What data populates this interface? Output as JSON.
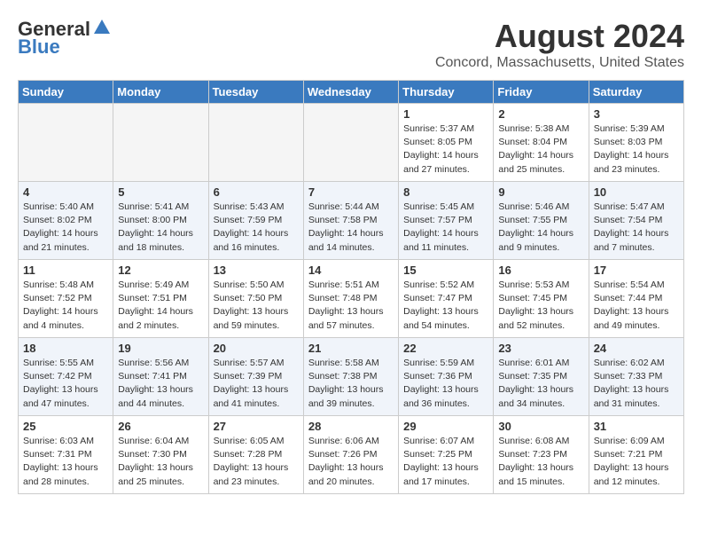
{
  "logo": {
    "general": "General",
    "blue": "Blue"
  },
  "title": "August 2024",
  "location": "Concord, Massachusetts, United States",
  "days_of_week": [
    "Sunday",
    "Monday",
    "Tuesday",
    "Wednesday",
    "Thursday",
    "Friday",
    "Saturday"
  ],
  "weeks": [
    [
      {
        "day": "",
        "info": ""
      },
      {
        "day": "",
        "info": ""
      },
      {
        "day": "",
        "info": ""
      },
      {
        "day": "",
        "info": ""
      },
      {
        "day": "1",
        "info": "Sunrise: 5:37 AM\nSunset: 8:05 PM\nDaylight: 14 hours and 27 minutes."
      },
      {
        "day": "2",
        "info": "Sunrise: 5:38 AM\nSunset: 8:04 PM\nDaylight: 14 hours and 25 minutes."
      },
      {
        "day": "3",
        "info": "Sunrise: 5:39 AM\nSunset: 8:03 PM\nDaylight: 14 hours and 23 minutes."
      }
    ],
    [
      {
        "day": "4",
        "info": "Sunrise: 5:40 AM\nSunset: 8:02 PM\nDaylight: 14 hours and 21 minutes."
      },
      {
        "day": "5",
        "info": "Sunrise: 5:41 AM\nSunset: 8:00 PM\nDaylight: 14 hours and 18 minutes."
      },
      {
        "day": "6",
        "info": "Sunrise: 5:43 AM\nSunset: 7:59 PM\nDaylight: 14 hours and 16 minutes."
      },
      {
        "day": "7",
        "info": "Sunrise: 5:44 AM\nSunset: 7:58 PM\nDaylight: 14 hours and 14 minutes."
      },
      {
        "day": "8",
        "info": "Sunrise: 5:45 AM\nSunset: 7:57 PM\nDaylight: 14 hours and 11 minutes."
      },
      {
        "day": "9",
        "info": "Sunrise: 5:46 AM\nSunset: 7:55 PM\nDaylight: 14 hours and 9 minutes."
      },
      {
        "day": "10",
        "info": "Sunrise: 5:47 AM\nSunset: 7:54 PM\nDaylight: 14 hours and 7 minutes."
      }
    ],
    [
      {
        "day": "11",
        "info": "Sunrise: 5:48 AM\nSunset: 7:52 PM\nDaylight: 14 hours and 4 minutes."
      },
      {
        "day": "12",
        "info": "Sunrise: 5:49 AM\nSunset: 7:51 PM\nDaylight: 14 hours and 2 minutes."
      },
      {
        "day": "13",
        "info": "Sunrise: 5:50 AM\nSunset: 7:50 PM\nDaylight: 13 hours and 59 minutes."
      },
      {
        "day": "14",
        "info": "Sunrise: 5:51 AM\nSunset: 7:48 PM\nDaylight: 13 hours and 57 minutes."
      },
      {
        "day": "15",
        "info": "Sunrise: 5:52 AM\nSunset: 7:47 PM\nDaylight: 13 hours and 54 minutes."
      },
      {
        "day": "16",
        "info": "Sunrise: 5:53 AM\nSunset: 7:45 PM\nDaylight: 13 hours and 52 minutes."
      },
      {
        "day": "17",
        "info": "Sunrise: 5:54 AM\nSunset: 7:44 PM\nDaylight: 13 hours and 49 minutes."
      }
    ],
    [
      {
        "day": "18",
        "info": "Sunrise: 5:55 AM\nSunset: 7:42 PM\nDaylight: 13 hours and 47 minutes."
      },
      {
        "day": "19",
        "info": "Sunrise: 5:56 AM\nSunset: 7:41 PM\nDaylight: 13 hours and 44 minutes."
      },
      {
        "day": "20",
        "info": "Sunrise: 5:57 AM\nSunset: 7:39 PM\nDaylight: 13 hours and 41 minutes."
      },
      {
        "day": "21",
        "info": "Sunrise: 5:58 AM\nSunset: 7:38 PM\nDaylight: 13 hours and 39 minutes."
      },
      {
        "day": "22",
        "info": "Sunrise: 5:59 AM\nSunset: 7:36 PM\nDaylight: 13 hours and 36 minutes."
      },
      {
        "day": "23",
        "info": "Sunrise: 6:01 AM\nSunset: 7:35 PM\nDaylight: 13 hours and 34 minutes."
      },
      {
        "day": "24",
        "info": "Sunrise: 6:02 AM\nSunset: 7:33 PM\nDaylight: 13 hours and 31 minutes."
      }
    ],
    [
      {
        "day": "25",
        "info": "Sunrise: 6:03 AM\nSunset: 7:31 PM\nDaylight: 13 hours and 28 minutes."
      },
      {
        "day": "26",
        "info": "Sunrise: 6:04 AM\nSunset: 7:30 PM\nDaylight: 13 hours and 25 minutes."
      },
      {
        "day": "27",
        "info": "Sunrise: 6:05 AM\nSunset: 7:28 PM\nDaylight: 13 hours and 23 minutes."
      },
      {
        "day": "28",
        "info": "Sunrise: 6:06 AM\nSunset: 7:26 PM\nDaylight: 13 hours and 20 minutes."
      },
      {
        "day": "29",
        "info": "Sunrise: 6:07 AM\nSunset: 7:25 PM\nDaylight: 13 hours and 17 minutes."
      },
      {
        "day": "30",
        "info": "Sunrise: 6:08 AM\nSunset: 7:23 PM\nDaylight: 13 hours and 15 minutes."
      },
      {
        "day": "31",
        "info": "Sunrise: 6:09 AM\nSunset: 7:21 PM\nDaylight: 13 hours and 12 minutes."
      }
    ]
  ]
}
